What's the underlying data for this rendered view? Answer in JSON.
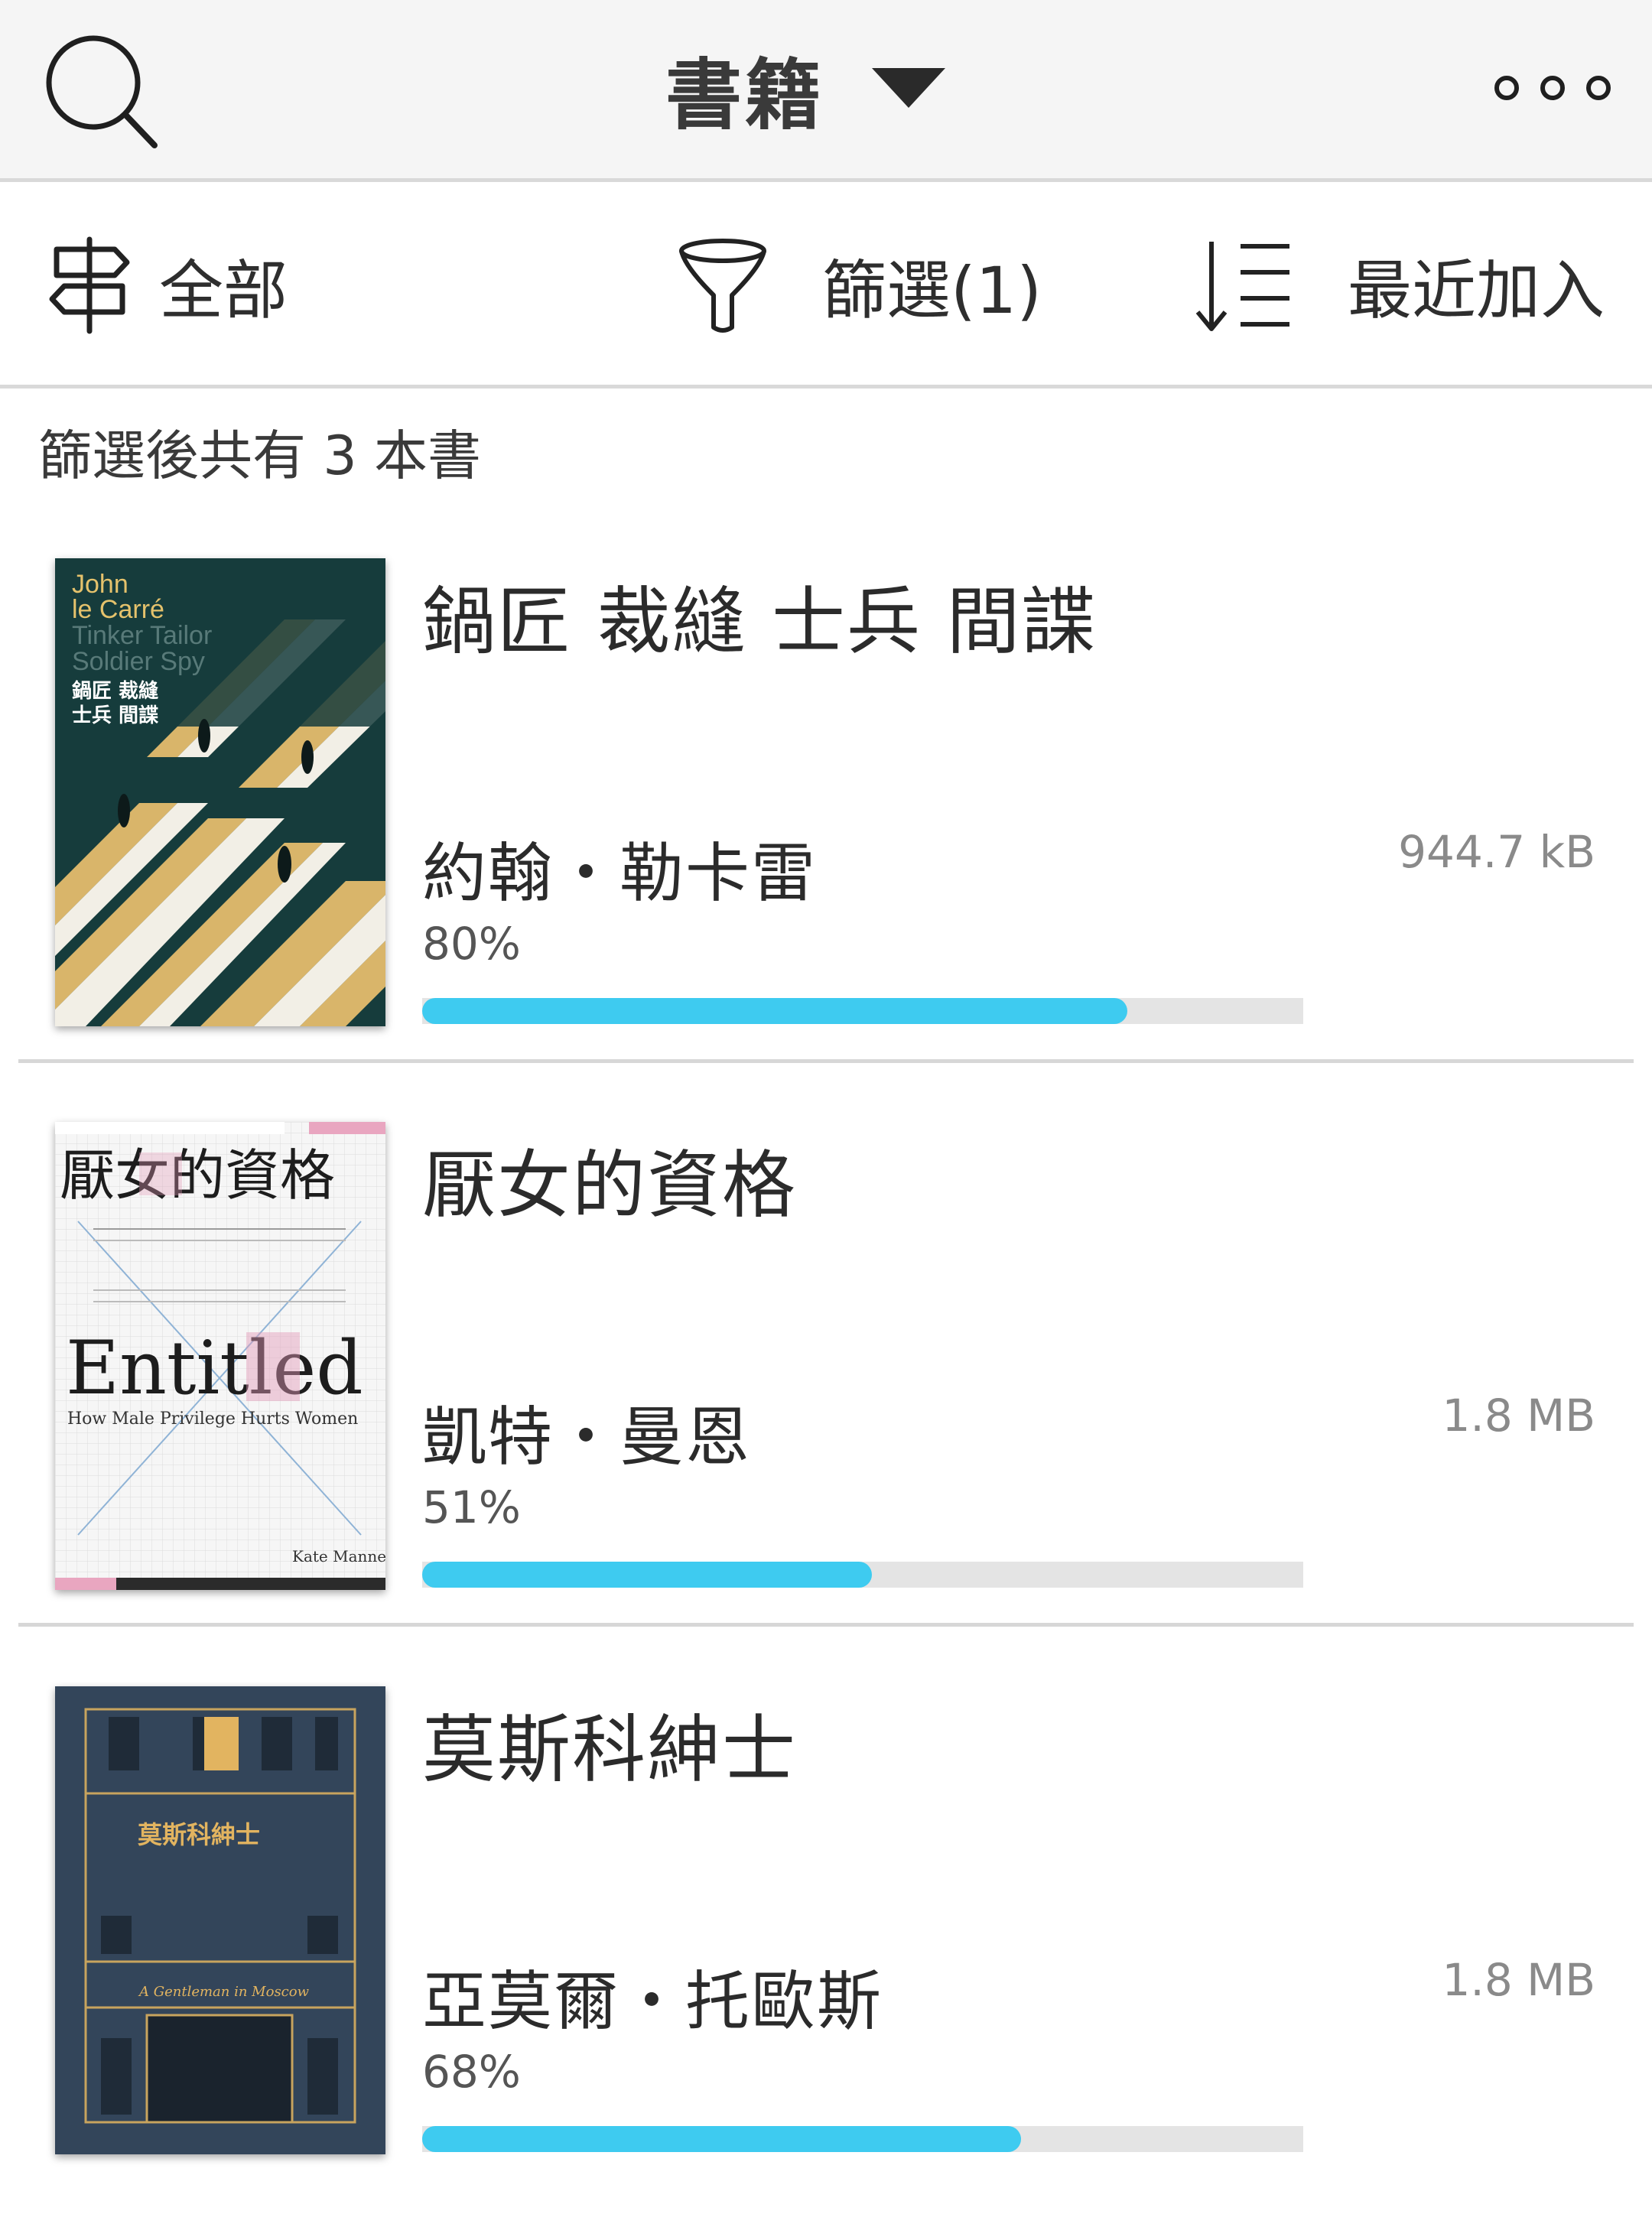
{
  "header": {
    "title": "書籍",
    "search_icon": "search-icon",
    "dropdown_icon": "caret-down-icon",
    "more_icon": "more-horizontal-icon"
  },
  "toolbar": {
    "all_label": "全部",
    "filter_label": "篩選(1)",
    "sort_label": "最近加入",
    "all_icon": "signpost-icon",
    "filter_icon": "funnel-icon",
    "sort_icon": "sort-list-icon"
  },
  "summary": {
    "count_text": "篩選後共有 3 本書"
  },
  "colors": {
    "progress": "#3ecbf0",
    "track": "#e4e4e4",
    "header_bg": "#f5f5f5"
  },
  "books": [
    {
      "title": "鍋匠 裁縫 士兵 間諜",
      "author": "約翰・勒卡雷",
      "size": "944.7 kB",
      "progress_label": "80%",
      "progress": 0.8,
      "cover": {
        "text_line1": "John",
        "text_line2": "le Carré",
        "text_line3": "Tinker Tailor",
        "text_line4": "Soldier Spy",
        "text_line5": "鍋匠 裁縫",
        "text_line6": "士兵 間諜"
      }
    },
    {
      "title": "厭女的資格",
      "author": "凱特・曼恩",
      "size": "1.8 MB",
      "progress_label": "51%",
      "progress": 0.51,
      "cover": {
        "title_cn": "厭女的資格",
        "title_en": "Entitled",
        "subtitle_en": "How Male Privilege Hurts Women",
        "author_en": "Kate Manne"
      }
    },
    {
      "title": "莫斯科紳士",
      "author": "亞莫爾・托歐斯",
      "size": "1.8 MB",
      "progress_label": "68%",
      "progress": 0.68,
      "cover": {
        "title_cn": "莫斯科紳士",
        "title_en": "A Gentleman in Moscow"
      }
    }
  ]
}
